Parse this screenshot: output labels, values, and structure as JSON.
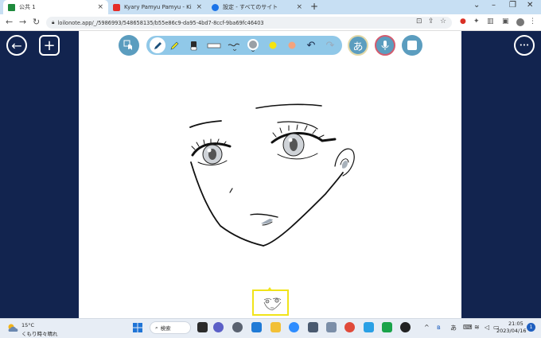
{
  "browser": {
    "tabs": [
      {
        "title": "公共 1",
        "active": true
      },
      {
        "title": "Kyary Pamyu Pamyu - Kizunami",
        "active": false
      },
      {
        "title": "設定 - すべてのサイト",
        "active": false
      }
    ],
    "close_glyph": "×",
    "newtab_glyph": "+",
    "url": "loilonote.app/_/5986993/548658135/b55e86c9-da95-4bd7-8ccf-9ba69fc46403"
  },
  "app": {
    "back_glyph": "←",
    "add_glyph": "+",
    "more_glyph": "•••",
    "ime_label": "あ",
    "colors": {
      "canvas_bg": "#12244f",
      "tool_pill": "#90c8e8",
      "tool_circle": "#5b9dbf",
      "mic": "#c0394f",
      "yellow": "#f4e40f",
      "orange": "#f3a37d",
      "gray": "#9aa0a6"
    }
  },
  "taskbar": {
    "weather_temp": "15°C",
    "weather_desc": "くもり時々晴れ",
    "search_label": "検索",
    "ime": "あ",
    "time": "21:05",
    "date": "2023/04/16",
    "notifications": "1"
  }
}
